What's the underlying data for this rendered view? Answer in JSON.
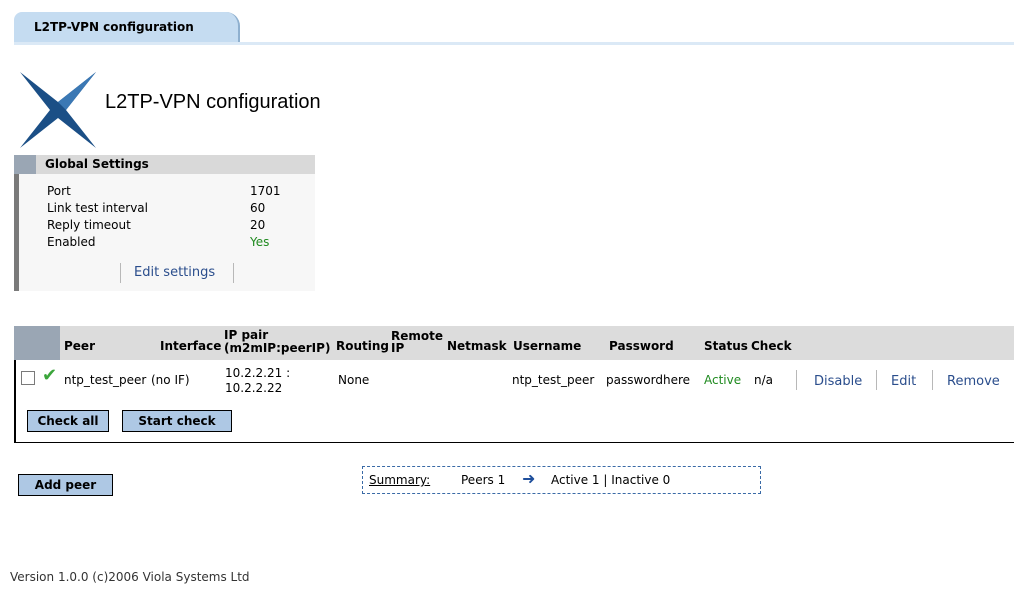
{
  "tab": {
    "label": "L2TP-VPN configuration"
  },
  "page": {
    "title": "L2TP-VPN configuration"
  },
  "global_settings": {
    "title": "Global Settings",
    "rows": [
      {
        "label": "Port",
        "value": "1701"
      },
      {
        "label": "Link test interval",
        "value": "60"
      },
      {
        "label": "Reply timeout",
        "value": "20"
      },
      {
        "label": "Enabled",
        "value": "Yes"
      }
    ],
    "edit_link": "Edit settings"
  },
  "peers_table": {
    "headers": {
      "peer": "Peer",
      "interface": "Interface",
      "ip_pair_line1": "IP pair",
      "ip_pair_line2": "(m2mIP:peerIP)",
      "routing": "Routing",
      "remote_ip_line1": "Remote",
      "remote_ip_line2": "IP",
      "netmask": "Netmask",
      "username": "Username",
      "password": "Password",
      "status": "Status",
      "check": "Check"
    },
    "rows": [
      {
        "peer": "ntp_test_peer",
        "interface": "(no IF)",
        "ip_pair_line1": "10.2.2.21 :",
        "ip_pair_line2": "10.2.2.22",
        "routing": "None",
        "remote_ip": "",
        "netmask": "",
        "username": "ntp_test_peer",
        "password": "passwordhere",
        "status": "Active",
        "check": "n/a",
        "actions": {
          "disable": "Disable",
          "edit": "Edit",
          "remove": "Remove"
        }
      }
    ],
    "buttons": {
      "check_all": "Check all",
      "start_check": "Start check"
    }
  },
  "add_peer_button": "Add peer",
  "summary": {
    "label": "Summary:",
    "peers": "Peers 1",
    "rest": "Active 1 | Inactive 0"
  },
  "footer": "Version 1.0.0 (c)2006 Viola Systems Ltd",
  "colors": {
    "accent": "#c5dcf1",
    "button": "#aec8e4",
    "link": "#2a4d8c",
    "active": "#1f8a1f"
  }
}
